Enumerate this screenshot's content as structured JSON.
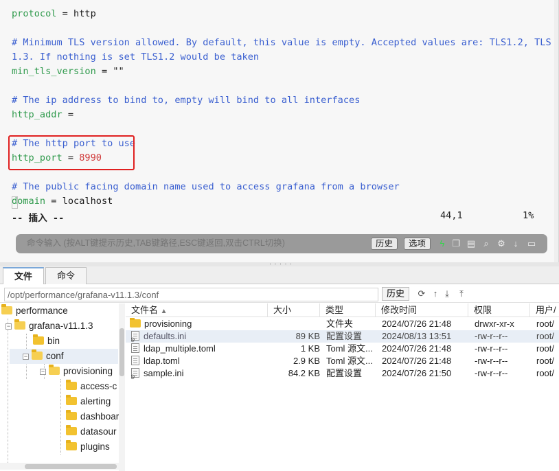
{
  "editor": {
    "lines": {
      "l1": {
        "key": "protocol",
        "op": " = ",
        "value": "http"
      },
      "l3": "# Minimum TLS version allowed. By default, this value is empty. Accepted values are: TLS1.2, TLS",
      "l4": "1.3. If nothing is set TLS1.2 would be taken",
      "l5": {
        "key": "min_tls_version",
        "op": " = ",
        "value": "\"\""
      },
      "l7": "# The ip address to bind to, empty will bind to all interfaces",
      "l8": {
        "key": "http_addr",
        "op": " ="
      },
      "l10": "# The http port to use",
      "l11": {
        "key": "http_port",
        "op": " = ",
        "value": "8990"
      },
      "l13": "# The public facing domain name used to access grafana from a browser",
      "l14": {
        "key": "domain",
        "op": " = ",
        "value": "localhost"
      }
    },
    "status": {
      "mode": "-- 插入 --",
      "position": "44,1",
      "percent": "1%"
    }
  },
  "command_bar": {
    "placeholder": "命令输入 (按ALT键提示历史,TAB键路径,ESC键返回,双击CTRL切换)",
    "history_label": "历史",
    "options_label": "选项",
    "icons": [
      "lightning-icon",
      "copy-icon",
      "paste-icon",
      "search-icon",
      "gear-icon",
      "download-icon",
      "maximize-icon"
    ]
  },
  "tabs": [
    {
      "label": "文件"
    },
    {
      "label": "命令"
    }
  ],
  "path_bar": {
    "path": "/opt/performance/grafana-v11.1.3/conf",
    "history_label": "历史",
    "icons": [
      "refresh-icon",
      "up-icon",
      "download-icon",
      "upload-icon"
    ]
  },
  "tree": {
    "items": [
      {
        "label": "performance"
      },
      {
        "label": "grafana-v11.1.3"
      },
      {
        "label": "bin"
      },
      {
        "label": "conf"
      },
      {
        "label": "provisioning"
      },
      {
        "label": "access-c"
      },
      {
        "label": "alerting"
      },
      {
        "label": "dashboar"
      },
      {
        "label": "datasour"
      },
      {
        "label": "plugins"
      }
    ]
  },
  "files": {
    "columns": [
      "文件名",
      "大小",
      "类型",
      "修改时间",
      "权限",
      "用户/"
    ],
    "rows": [
      {
        "name": "provisioning",
        "size": "",
        "type": "文件夹",
        "modified": "2024/07/26 21:48",
        "perm": "drwxr-xr-x",
        "owner": "root/"
      },
      {
        "name": "defaults.ini",
        "size": "89 KB",
        "type": "配置设置",
        "modified": "2024/08/13 13:51",
        "perm": "-rw-r--r--",
        "owner": "root/"
      },
      {
        "name": "ldap_multiple.toml",
        "size": "1 KB",
        "type": "Toml 源文...",
        "modified": "2024/07/26 21:48",
        "perm": "-rw-r--r--",
        "owner": "root/"
      },
      {
        "name": "ldap.toml",
        "size": "2.9 KB",
        "type": "Toml 源文...",
        "modified": "2024/07/26 21:48",
        "perm": "-rw-r--r--",
        "owner": "root/"
      },
      {
        "name": "sample.ini",
        "size": "84.2 KB",
        "type": "配置设置",
        "modified": "2024/07/26 21:50",
        "perm": "-rw-r--r--",
        "owner": "root/"
      }
    ]
  }
}
